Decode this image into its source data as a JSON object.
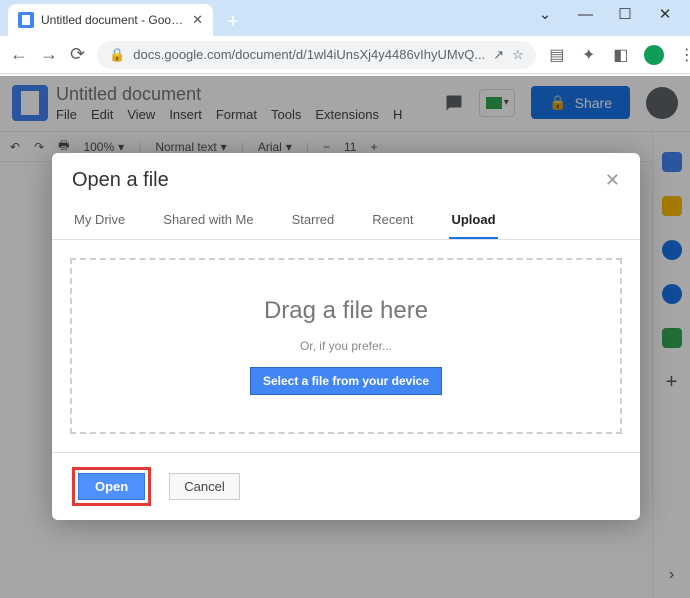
{
  "browser": {
    "tab_title": "Untitled document - Google Doc...",
    "url": "docs.google.com/document/d/1wl4iUnsXj4y4486vIhyUMvQ..."
  },
  "docs": {
    "title": "Untitled document",
    "menus": [
      "File",
      "Edit",
      "View",
      "Insert",
      "Format",
      "Tools",
      "Extensions",
      "H"
    ],
    "share_label": "Share",
    "toolbar": {
      "zoom": "100%",
      "style": "Normal text",
      "font": "Arial",
      "size": "11"
    }
  },
  "modal": {
    "title": "Open a file",
    "tabs": {
      "my_drive": "My Drive",
      "shared": "Shared with Me",
      "starred": "Starred",
      "recent": "Recent",
      "upload": "Upload"
    },
    "drop_title": "Drag a file here",
    "drop_sub": "Or, if you prefer...",
    "select_label": "Select a file from your device",
    "open_label": "Open",
    "cancel_label": "Cancel"
  }
}
